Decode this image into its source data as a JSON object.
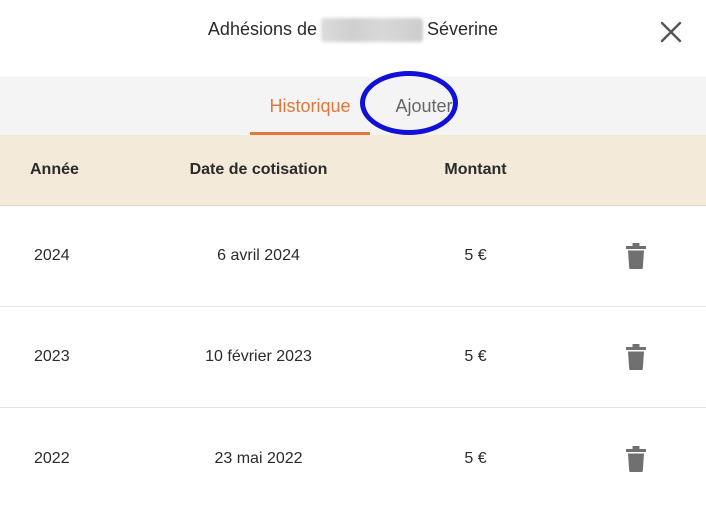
{
  "dialog": {
    "title_prefix": "Adhésions de",
    "title_suffix": "Séverine",
    "close_icon": "close-icon"
  },
  "tabs": [
    {
      "label": "Historique",
      "active": true
    },
    {
      "label": "Ajouter",
      "active": false
    }
  ],
  "table": {
    "headers": {
      "year": "Année",
      "date": "Date de cotisation",
      "amount": "Montant"
    },
    "rows": [
      {
        "year": "2024",
        "date": "6 avril 2024",
        "amount": "5 €"
      },
      {
        "year": "2023",
        "date": "10 février 2023",
        "amount": "5 €"
      },
      {
        "year": "2022",
        "date": "23 mai 2022",
        "amount": "5 €"
      }
    ]
  },
  "colors": {
    "accent": "#e3763a",
    "header_bg": "#f3ead9",
    "tabs_bg": "#f4f4f4",
    "highlight": "#1010d8",
    "trash": "#707070"
  }
}
